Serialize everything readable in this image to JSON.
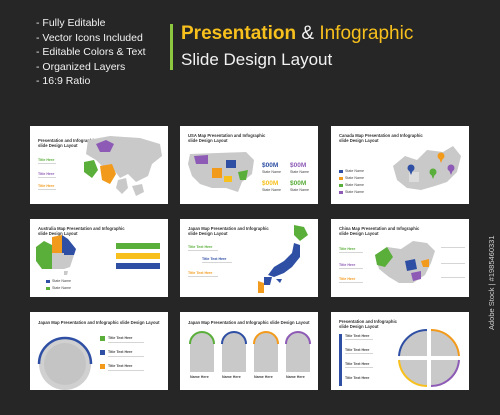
{
  "features": [
    "- Fully Editable",
    "- Vector Icons Included",
    "- Editable Colors & Text",
    "- Organized Layers",
    "- 16:9 Ratio"
  ],
  "hero": {
    "title_part1": "Presentation",
    "title_amp": " & ",
    "title_part2": "Infographic",
    "subtitle": "Slide Design Layout"
  },
  "slides": [
    {
      "title_l1": "Presentation and Infographic",
      "title_l2": "slide Design Layout",
      "labels": [
        "Title Here",
        "Title Here",
        "Title Here"
      ]
    },
    {
      "title_l1": "USA Map Presentation and Infographic",
      "title_l2": "slide Design Layout",
      "values": [
        "$00M",
        "$00M",
        "$00M",
        "$00M"
      ],
      "labels": [
        "State Name",
        "State Name",
        "State Name",
        "State Name"
      ]
    },
    {
      "title_l1": "Canada Map Presentation and Infographic",
      "title_l2": "slide Design Layout",
      "labels": [
        "State Name",
        "State Name",
        "State Name",
        "State Name"
      ]
    },
    {
      "title_l1": "Australia Map Presentation and Infographic",
      "title_l2": "slide Design Layout",
      "labels": [
        "State Name",
        "State Name"
      ]
    },
    {
      "title_l1": "Japan Map Presentation and Infographic",
      "title_l2": "slide Design Layout",
      "labels": [
        "Title Text Here",
        "Title Text Here",
        "Title Text Here"
      ]
    },
    {
      "title_l1": "China Map Presentation and Infographic",
      "title_l2": "slide Design Layout",
      "labels": [
        "Title Here",
        "Title Here",
        "Title Here"
      ]
    },
    {
      "title_l1": "Japan Map Presentation and Infographic slide Design Layout",
      "labels": [
        "Title Text Here",
        "Title Text Here",
        "Title Text Here"
      ]
    },
    {
      "title_l1": "Japan Map Presentation and Infographic slide Design Layout",
      "labels": [
        "Name Here",
        "Name Here",
        "Name Here",
        "Name Here"
      ]
    },
    {
      "title_l1": "Presentation and Infographic",
      "title_l2": "slide Design Layout",
      "labels": [
        "Title Text Here",
        "Title Text Here",
        "Title Text Here",
        "Title Text Here"
      ]
    }
  ],
  "colors": {
    "green": "#5aae3a",
    "purple": "#8d5bb5",
    "orange": "#f29a1c",
    "blue": "#2e4fa3",
    "yellow": "#f7c01d",
    "grey": "#c9c9c9",
    "background": "#262626"
  },
  "side_id": "Adobe Stock | #1985460331"
}
